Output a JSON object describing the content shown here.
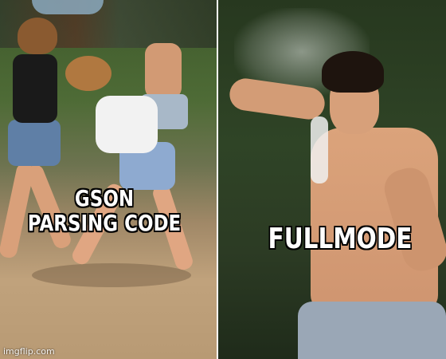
{
  "captions": {
    "left_line1": "GSON",
    "left_line2": "PARSING CODE",
    "right": "FULLMODE"
  },
  "watermark": "imgflip.com",
  "colors": {
    "caption_fill": "#ffffff",
    "caption_outline": "#000000",
    "divider": "#ffffff"
  }
}
